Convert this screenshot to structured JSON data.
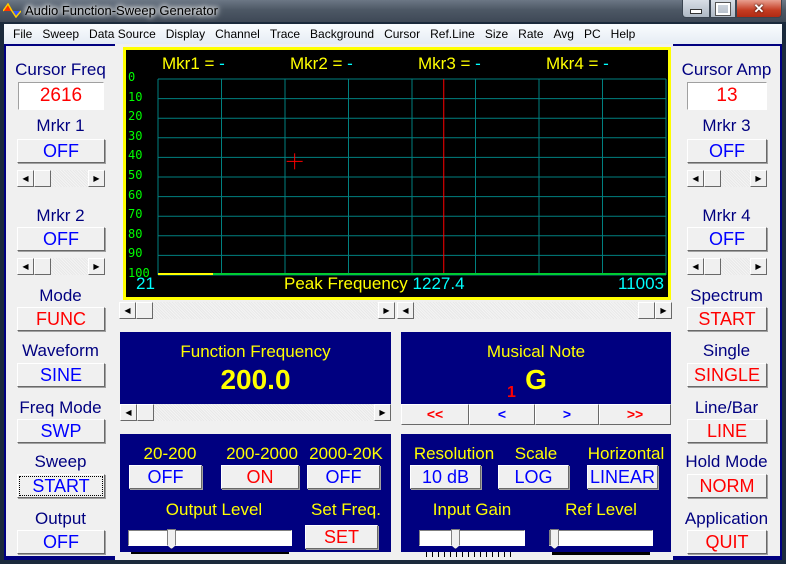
{
  "window": {
    "title": "Audio Function-Sweep Generator",
    "minimize": "minimize",
    "maximize": "maximize",
    "close": "✕"
  },
  "menu": [
    "File",
    "Sweep",
    "Data Source",
    "Display",
    "Channel",
    "Trace",
    "Background",
    "Cursor",
    "Ref.Line",
    "Size",
    "Rate",
    "Avg",
    "PC",
    "Help"
  ],
  "left": {
    "cursor_freq_label": "Cursor Freq",
    "cursor_freq_value": "2616",
    "mrkr1_label": "Mrkr 1",
    "mrkr1_value": "OFF",
    "mrkr2_label": "Mrkr 2",
    "mrkr2_value": "OFF",
    "mode_label": "Mode",
    "mode_value": "FUNC",
    "waveform_label": "Waveform",
    "waveform_value": "SINE",
    "freq_mode_label": "Freq Mode",
    "freq_mode_value": "SWP",
    "sweep_label": "Sweep",
    "sweep_value": "START",
    "output_label": "Output",
    "output_value": "OFF"
  },
  "right": {
    "cursor_amp_label": "Cursor Amp",
    "cursor_amp_value": "13",
    "mrkr3_label": "Mrkr 3",
    "mrkr3_value": "OFF",
    "mrkr4_label": "Mrkr 4",
    "mrkr4_value": "OFF",
    "spectrum_label": "Spectrum",
    "spectrum_value": "START",
    "single_label": "Single",
    "single_value": "SINGLE",
    "linebar_label": "Line/Bar",
    "linebar_value": "LINE",
    "hold_label": "Hold Mode",
    "hold_value": "NORM",
    "application_label": "Application",
    "application_value": "QUIT"
  },
  "graph": {
    "markers": [
      {
        "label": "Mkr1 = ",
        "value": "-"
      },
      {
        "label": "Mkr2 = ",
        "value": "-"
      },
      {
        "label": "Mkr3 = ",
        "value": "-"
      },
      {
        "label": "Mkr4 = ",
        "value": "-"
      }
    ],
    "y_ticks": [
      "0",
      "10",
      "20",
      "30",
      "40",
      "50",
      "60",
      "70",
      "80",
      "90",
      "100"
    ],
    "x_min": "21",
    "x_max": "11003",
    "peak_label": "Peak Frequency",
    "peak_value": "1227.4",
    "colors": {
      "grid": "#008080",
      "cursor_line": "#ff0000",
      "trace": "#00cc33",
      "trace_start": "#ffff00",
      "border": "#ffff00"
    }
  },
  "function_frequency": {
    "label": "Function Frequency",
    "value": "200.0"
  },
  "musical_note": {
    "label": "Musical Note",
    "note": "G",
    "octave": "1",
    "nav": [
      "<<",
      "<",
      ">",
      ">>"
    ]
  },
  "range": {
    "labels": [
      "20-200",
      "200-2000",
      "2000-20K"
    ],
    "values": [
      "OFF",
      "ON",
      "OFF"
    ],
    "output_level_label": "Output Level",
    "output_level": 0.25,
    "set_freq_label": "Set Freq.",
    "set_value": "SET"
  },
  "analyzer": {
    "resolution_label": "Resolution",
    "resolution_value": "10 dB",
    "scale_label": "Scale",
    "scale_value": "LOG",
    "horizontal_label": "Horizontal",
    "horizontal_value": "LINEAR",
    "input_gain_label": "Input Gain",
    "input_gain": 0.33,
    "ref_level_label": "Ref Level",
    "ref_level": 0.0
  }
}
